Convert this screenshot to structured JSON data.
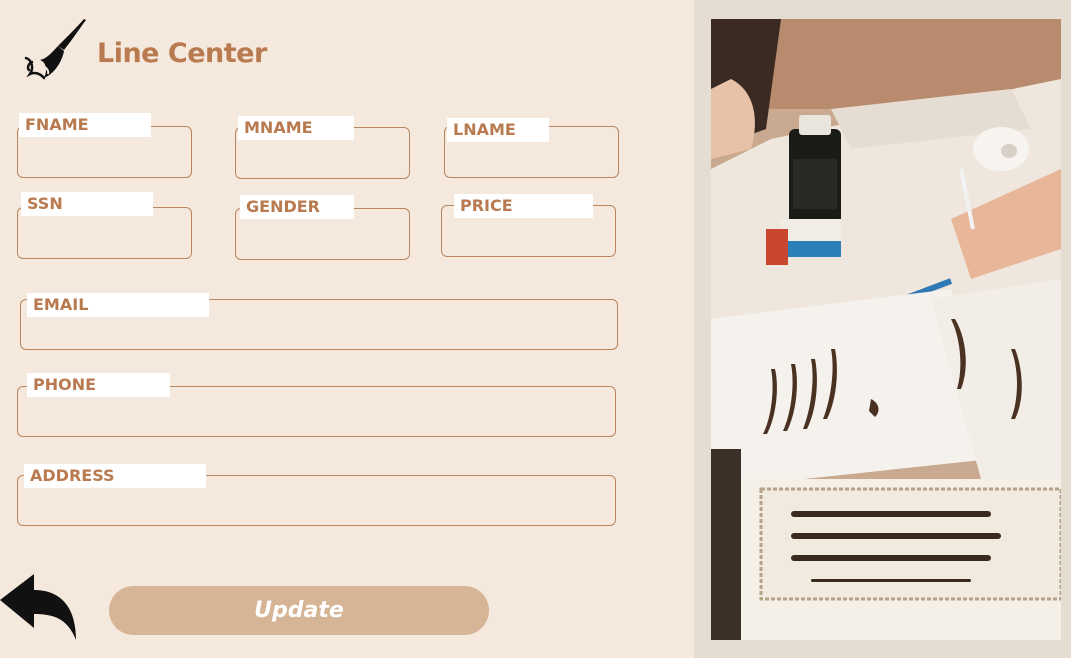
{
  "app": {
    "title": "Line Center"
  },
  "form": {
    "fname_label": "FNAME",
    "mname_label": "MNAME",
    "lname_label": "LNAME",
    "ssn_label": "SSN",
    "gender_label": "GENDER",
    "price_label": "PRICE",
    "email_label": "EMAIL",
    "phone_label": "PHONE",
    "address_label": "ADDRESS",
    "fname_value": "",
    "mname_value": "",
    "lname_value": "",
    "ssn_value": "",
    "gender_value": "",
    "price_value": "",
    "email_value": "",
    "phone_value": "",
    "address_value": ""
  },
  "actions": {
    "update_label": "Update"
  },
  "icons": {
    "logo": "paintbrush-icon",
    "back": "back-arrow-icon"
  },
  "colors": {
    "accent": "#b87a4e",
    "background": "#f5e8dd",
    "button": "#d6b596",
    "panel": "#e6ddd2"
  }
}
